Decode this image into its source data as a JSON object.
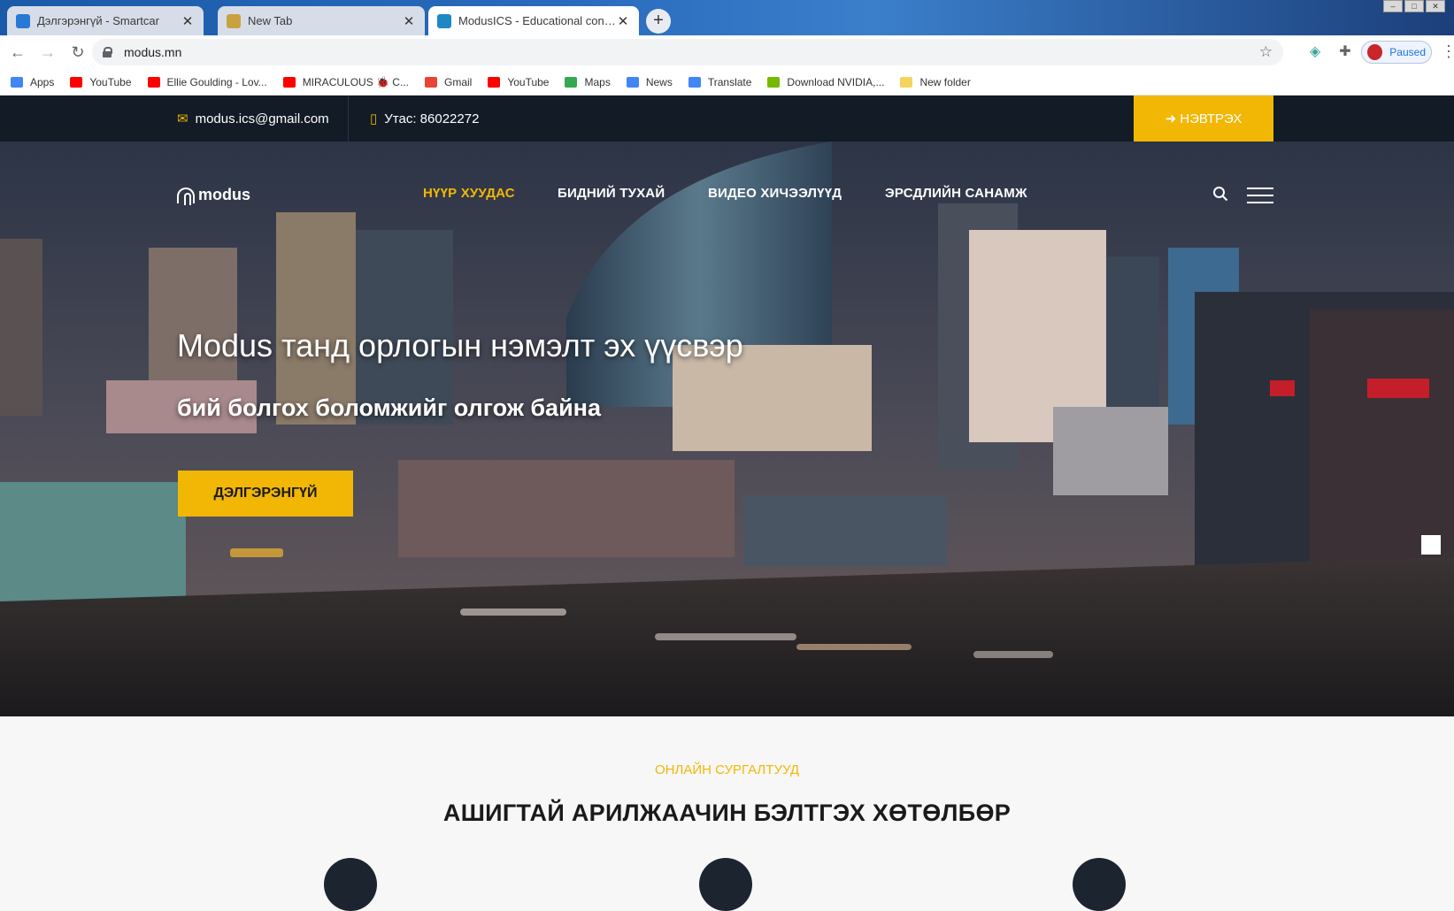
{
  "browser": {
    "tabs": [
      {
        "title": "Дэлгэрэнгүй - Smartcar",
        "favicon": "smartcar-icon",
        "active": false
      },
      {
        "title": "New Tab",
        "favicon": "newtab-icon",
        "active": false
      },
      {
        "title": "ModusICS - Educational consulta",
        "favicon": "modus-icon",
        "active": true
      }
    ],
    "url": "modus.mn",
    "profile_status": "Paused",
    "bookmarks": [
      {
        "label": "Apps",
        "icon": "apps-grid-icon",
        "color": "#4285f4"
      },
      {
        "label": "YouTube",
        "icon": "youtube-icon",
        "color": "#ff0000"
      },
      {
        "label": "Ellie Goulding - Lov...",
        "icon": "youtube-icon",
        "color": "#ff0000"
      },
      {
        "label": "MIRACULOUS 🐞 C...",
        "icon": "youtube-icon",
        "color": "#ff0000"
      },
      {
        "label": "Gmail",
        "icon": "google-icon",
        "color": "#ea4335"
      },
      {
        "label": "YouTube",
        "icon": "youtube-icon",
        "color": "#ff0000"
      },
      {
        "label": "Maps",
        "icon": "maps-pin-icon",
        "color": "#34a853"
      },
      {
        "label": "News",
        "icon": "news-icon",
        "color": "#4285f4"
      },
      {
        "label": "Translate",
        "icon": "translate-icon",
        "color": "#4285f4"
      },
      {
        "label": "Download NVIDIA,...",
        "icon": "nvidia-icon",
        "color": "#76b900"
      },
      {
        "label": "New folder",
        "icon": "folder-icon",
        "color": "#f6d35b"
      }
    ]
  },
  "site": {
    "topbar": {
      "email": "modus.ics@gmail.com",
      "phone": "Утас: 86022272",
      "login_label": "НЭВТРЭХ"
    },
    "logo_text": "modus",
    "nav": [
      {
        "label": "НҮҮР ХУУДАС",
        "active": true
      },
      {
        "label": "БИДНИЙ ТУХАЙ",
        "active": false
      },
      {
        "label": "ВИДЕО ХИЧЭЭЛҮҮД",
        "active": false
      },
      {
        "label": "ЭРСДЛИЙН САНАМЖ",
        "active": false
      }
    ],
    "hero": {
      "headline": "Modus танд орлогын нэмэлт эх үүсвэр",
      "subheadline": "бий болгох боломжийг олгож байна",
      "cta_label": "ДЭЛГЭРЭНГҮЙ"
    },
    "section": {
      "eyebrow": "ОНЛАЙН СУРГАЛТУУД",
      "title": "АШИГТАЙ АРИЛЖААЧИН БЭЛТГЭХ ХӨТӨЛБӨР"
    },
    "accent_color": "#f2b705",
    "dark_color": "#121b26"
  }
}
